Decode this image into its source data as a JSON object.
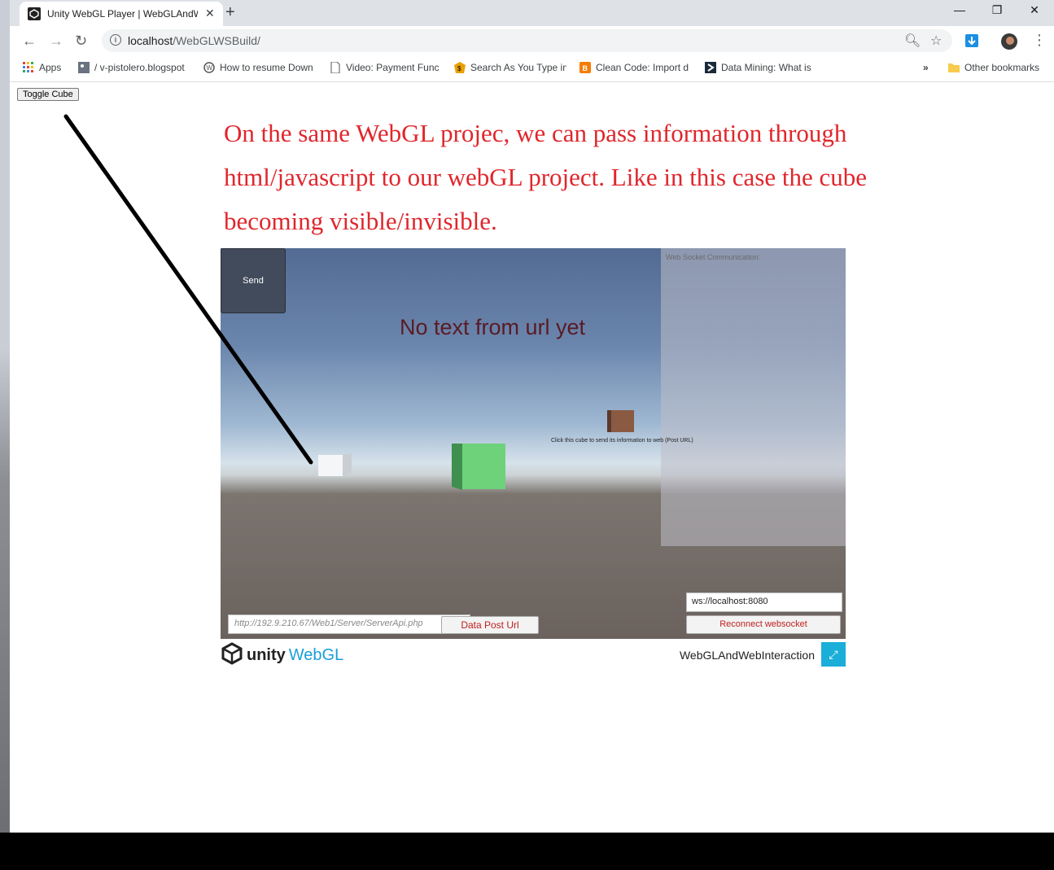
{
  "browser": {
    "tab_title": "Unity WebGL Player | WebGLAndWebInteraction",
    "tab_close": "✕",
    "new_tab": "+",
    "url_host": "localhost",
    "url_path": "/WebGLWSBuild/",
    "window_controls": {
      "minimize": "—",
      "restore": "❐",
      "close": "✕"
    }
  },
  "bookmarks": [
    {
      "label": "Apps",
      "icon": "apps-grid-icon"
    },
    {
      "label": "/ v-pistolero.blogspot",
      "icon": "image-icon"
    },
    {
      "label": "How to resume Down",
      "icon": "wordpress-icon"
    },
    {
      "label": "Video: Payment Func",
      "icon": "page-icon"
    },
    {
      "label": "Search As You Type in",
      "icon": "badge-icon"
    },
    {
      "label": "Clean Code: Import d",
      "icon": "blogger-icon"
    },
    {
      "label": "Data Mining: What is",
      "icon": "pluralsight-icon"
    }
  ],
  "bookmarks_overflow": "»",
  "other_bookmarks": "Other bookmarks",
  "page": {
    "toggle_button": "Toggle Cube",
    "annotation": "On the same WebGL projec, we can pass information through html/javascript  to our webGL project. Like in this case the cube becoming visible/invisible."
  },
  "canvas": {
    "send_button": "Send",
    "center_text": "No text from url yet",
    "ws_panel_label": "Web Socket Communication:",
    "cube_hint": "Click this cube to send its information to web (Post URL)",
    "post_url_placeholder": "http://192.9.210.67/Web1/Server/ServerApi.php",
    "post_button": "Data Post Url",
    "ws_address": "ws://localhost:8080",
    "reconnect_button": "Reconnect websocket"
  },
  "footer": {
    "unity": "unity",
    "webgl": "WebGL",
    "project_title": "WebGLAndWebInteraction"
  },
  "colors": {
    "annotation": "#e0262c",
    "webgl_accent": "#1a9ed8",
    "fullscreen_bg": "#1aaed9"
  }
}
